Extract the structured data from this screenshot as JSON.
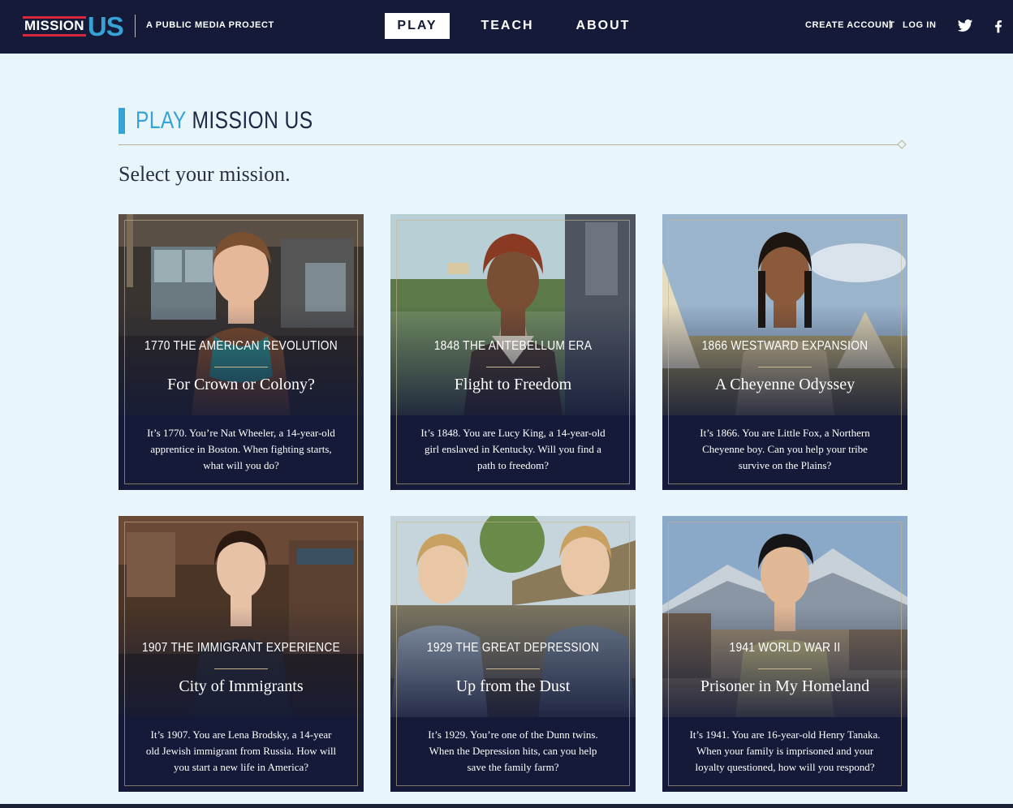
{
  "header": {
    "logo_mission": "MISSION",
    "logo_us": "US",
    "tagline": "A PUBLIC MEDIA PROJECT",
    "nav": {
      "play": "PLAY",
      "teach": "TEACH",
      "about": "ABOUT"
    },
    "account": {
      "create": "CREATE ACCOUNT",
      "separator": "|",
      "login": "LOG IN"
    },
    "social": [
      "twitter-icon",
      "facebook-icon"
    ]
  },
  "page": {
    "heading_accent": "PLAY",
    "heading_main": "MISSION US",
    "subtitle": "Select your mission."
  },
  "colors": {
    "navy": "#141a38",
    "accent_blue": "#36a3d4",
    "logo_red": "#d7263d",
    "background": "#e8f6fb",
    "gold_rule": "#b9b091"
  },
  "missions": [
    {
      "era": "1770 THE AMERICAN REVOLUTION",
      "title": "For Crown or Colony?",
      "desc1": "It’s 1770. You’re Nat Wheeler, a 14-year-old",
      "desc2": "apprentice in Boston. When fighting starts,",
      "desc3": "what will you do?"
    },
    {
      "era": "1848 THE ANTEBELLUM ERA",
      "title": "Flight to Freedom",
      "desc1": "It’s 1848. You are Lucy King, a 14-year-old",
      "desc2": "girl enslaved in Kentucky. Will you find a",
      "desc3": "path to freedom?"
    },
    {
      "era": "1866 WESTWARD EXPANSION",
      "title": "A Cheyenne Odyssey",
      "desc1": "It’s 1866. You are Little Fox, a Northern",
      "desc2": "Cheyenne boy. Can you help your tribe",
      "desc3": "survive on the Plains?"
    },
    {
      "era": "1907 THE IMMIGRANT EXPERIENCE",
      "title": "City of Immigrants",
      "desc1": "It’s 1907. You are Lena Brodsky, a 14-year",
      "desc2": "old Jewish immigrant from Russia. How will",
      "desc3": "you start a new life in America?"
    },
    {
      "era": "1929 THE GREAT DEPRESSION",
      "title": "Up from the Dust",
      "desc1": "It’s 1929. You’re one of the Dunn twins.",
      "desc2": "When the Depression hits, can you help",
      "desc3": "save the family farm?"
    },
    {
      "era": "1941 WORLD WAR II",
      "title": "Prisoner in My Homeland",
      "desc1": "It’s 1941. You are 16-year-old Henry Tanaka.",
      "desc2": "When your family is imprisoned and your",
      "desc3": "loyalty questioned, how will you respond?"
    }
  ]
}
